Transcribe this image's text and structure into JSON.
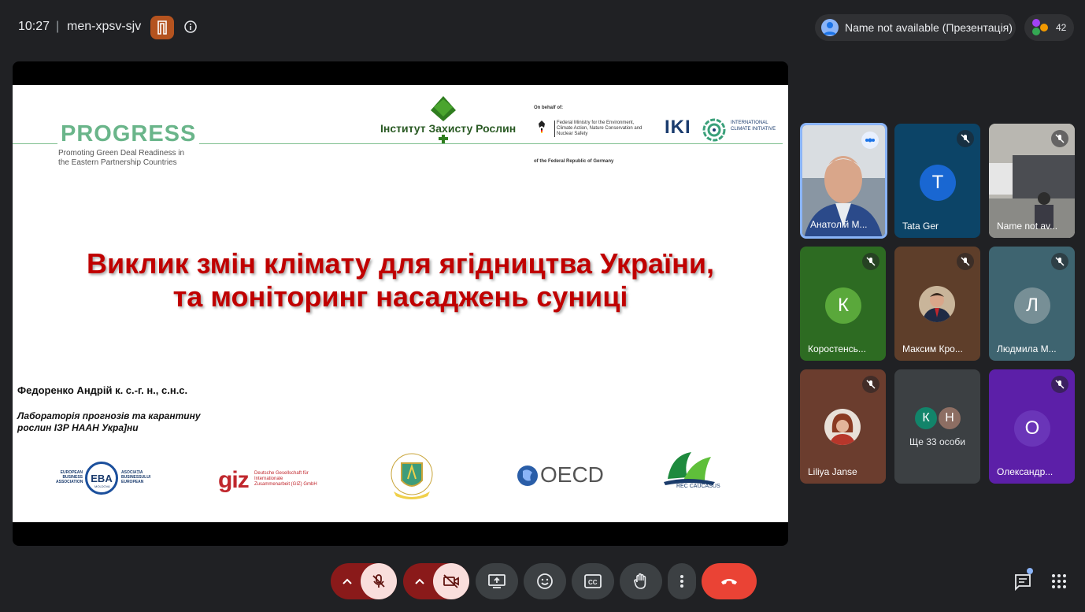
{
  "topbar": {
    "time": "10:27",
    "separator": "|",
    "meeting_code": "men-xpsv-sjv",
    "presenter_label": "Name not available (Презентація)",
    "participants_count": "42"
  },
  "slide": {
    "progress_title": "PROGRESS",
    "progress_subtitle": "Promoting Green Deal Readiness in the Eastern Partnership Countries",
    "institute_name": "Інститут Захисту Рослин",
    "on_behalf": "On behalf of:",
    "ministry": "Federal Ministry for the Environment, Climate Action, Nature Conservation and Nuclear Safety",
    "federal_republic": "of the Federal Republic of Germany",
    "iki": "IKI",
    "iki_sub": "INTERNATIONAL CLIMATE INITIATIVE",
    "title_line1": "Виклик змін клімату для ягідництва України,",
    "title_line2": "та моніторинг насаджень суниці",
    "author": "Федоренко Андрій к. с.-г. н., с.н.с.",
    "lab_line1": "Лабораторія прогнозів та карантину",
    "lab_line2": "рослин ІЗР НААН Укра]ни",
    "eba_left": "EUROPEAN BUSINESS ASSOCIATION",
    "eba": "EBA",
    "eba_moldova": "MOLDOVA",
    "eba_right": "ASOCIAȚIA BUSINESSULUI EUROPEAN",
    "giz": "giz",
    "giz_sub": "Deutsche Gesellschaft für Internationale Zusammenarbeit (GIZ) GmbH",
    "oecd": "OECD",
    "rec": "REC CAUCASUS"
  },
  "participants": [
    {
      "name": "Анатолій М..."
    },
    {
      "name": "Tata Ger",
      "initial": "T"
    },
    {
      "name": "Name not av..."
    },
    {
      "name": "Коростенсь...",
      "initial": "К"
    },
    {
      "name": "Максим Кро..."
    },
    {
      "name": "Людмила М...",
      "initial": "Л"
    },
    {
      "name": "Liliya Janse"
    },
    {
      "name": "Ще 33 особи",
      "initials": [
        "К",
        "Н"
      ]
    },
    {
      "name": "Олександр...",
      "initial": "О"
    }
  ],
  "colors": {
    "accent_blue": "#8ab4f8",
    "end_call": "#ea4335",
    "slide_title": "#c00000"
  }
}
